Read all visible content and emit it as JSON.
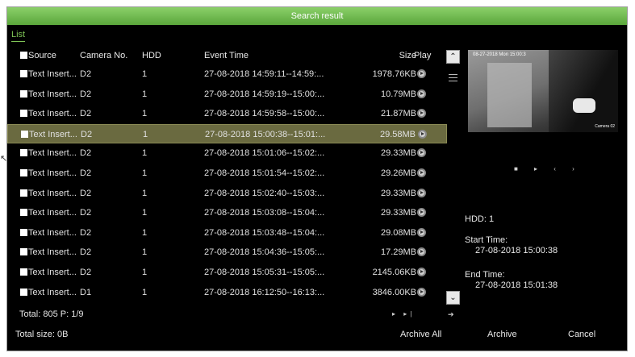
{
  "window": {
    "title": "Search result"
  },
  "tabs": {
    "list": "List"
  },
  "table": {
    "headers": {
      "source": "Source",
      "camera": "Camera No.",
      "hdd": "HDD",
      "event_time": "Event Time",
      "size": "Size",
      "play": "Play"
    },
    "rows": [
      {
        "source": "Text Insert...",
        "camera": "D2",
        "hdd": "1",
        "time": "27-08-2018 14:59:11--14:59:...",
        "size": "1978.76KB",
        "selected": false
      },
      {
        "source": "Text Insert...",
        "camera": "D2",
        "hdd": "1",
        "time": "27-08-2018 14:59:19--15:00:...",
        "size": "10.79MB",
        "selected": false
      },
      {
        "source": "Text Insert...",
        "camera": "D2",
        "hdd": "1",
        "time": "27-08-2018 14:59:58--15:00:...",
        "size": "21.87MB",
        "selected": false
      },
      {
        "source": "Text Insert...",
        "camera": "D2",
        "hdd": "1",
        "time": "27-08-2018 15:00:38--15:01:...",
        "size": "29.58MB",
        "selected": true
      },
      {
        "source": "Text Insert...",
        "camera": "D2",
        "hdd": "1",
        "time": "27-08-2018 15:01:06--15:02:...",
        "size": "29.33MB",
        "selected": false
      },
      {
        "source": "Text Insert...",
        "camera": "D2",
        "hdd": "1",
        "time": "27-08-2018 15:01:54--15:02:...",
        "size": "29.26MB",
        "selected": false
      },
      {
        "source": "Text Insert...",
        "camera": "D2",
        "hdd": "1",
        "time": "27-08-2018 15:02:40--15:03:...",
        "size": "29.33MB",
        "selected": false
      },
      {
        "source": "Text Insert...",
        "camera": "D2",
        "hdd": "1",
        "time": "27-08-2018 15:03:08--15:04:...",
        "size": "29.33MB",
        "selected": false
      },
      {
        "source": "Text Insert...",
        "camera": "D2",
        "hdd": "1",
        "time": "27-08-2018 15:03:48--15:04:...",
        "size": "29.08MB",
        "selected": false
      },
      {
        "source": "Text Insert...",
        "camera": "D2",
        "hdd": "1",
        "time": "27-08-2018 15:04:36--15:05:...",
        "size": "17.29MB",
        "selected": false
      },
      {
        "source": "Text Insert...",
        "camera": "D2",
        "hdd": "1",
        "time": "27-08-2018 15:05:31--15:05:...",
        "size": "2145.06KB",
        "selected": false
      },
      {
        "source": "Text Insert...",
        "camera": "D1",
        "hdd": "1",
        "time": "27-08-2018 16:12:50--16:13:...",
        "size": "3846.00KB",
        "selected": false
      }
    ]
  },
  "preview": {
    "osd_text": "08-27-2018 Mon 15:00:3",
    "camera_label": "Camera 02"
  },
  "details": {
    "hdd": "HDD: 1",
    "start_label": "Start Time:",
    "start_value": "27-08-2018 15:00:38",
    "end_label": "End Time:",
    "end_value": "27-08-2018 15:01:38"
  },
  "footer": {
    "total": "Total: 805  P: 1/9",
    "total_size": "Total size: 0B",
    "archive_all": "Archive All",
    "archive": "Archive",
    "cancel": "Cancel"
  },
  "icons": {
    "playback_controls": "■ ▸ ‹ ›",
    "pager": "▸ ▸|",
    "arrow": "➔",
    "scroll_up": "⌃",
    "scroll_down": "⌄"
  },
  "colors": {
    "accent": "#6cbf45",
    "selected_row": "#6a6a40"
  }
}
